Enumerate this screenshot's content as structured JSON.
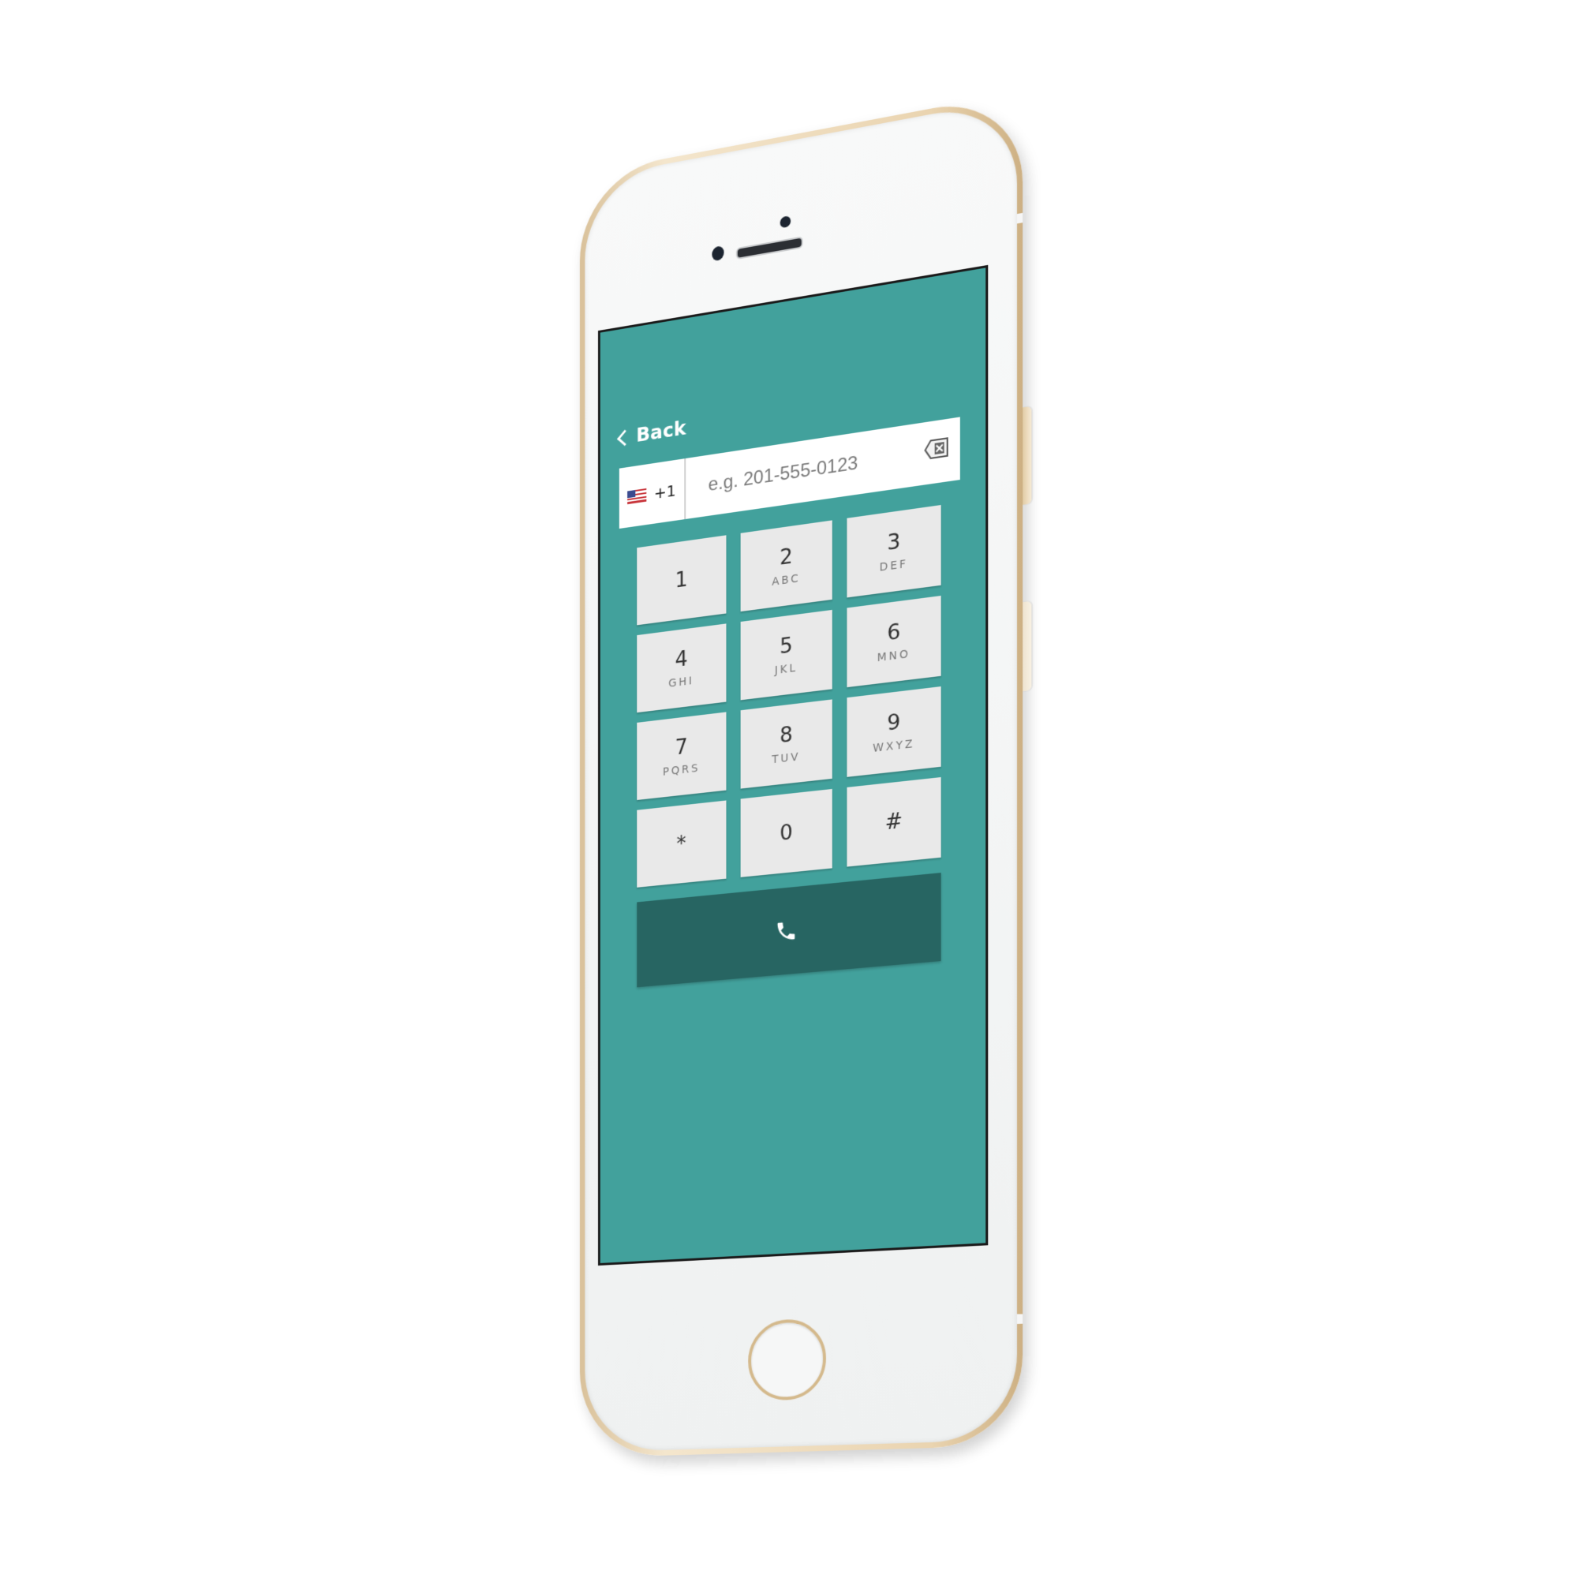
{
  "header": {
    "back_label": "Back"
  },
  "phone_input": {
    "country_code": "+1",
    "country_flag": "us-flag-icon",
    "placeholder": "e.g. 201-555-0123",
    "value": "",
    "clear_icon": "backspace-icon"
  },
  "keypad": {
    "keys": [
      {
        "digit": "1",
        "letters": ""
      },
      {
        "digit": "2",
        "letters": "ABC"
      },
      {
        "digit": "3",
        "letters": "DEF"
      },
      {
        "digit": "4",
        "letters": "GHI"
      },
      {
        "digit": "5",
        "letters": "JKL"
      },
      {
        "digit": "6",
        "letters": "MNO"
      },
      {
        "digit": "7",
        "letters": "PQRS"
      },
      {
        "digit": "8",
        "letters": "TUV"
      },
      {
        "digit": "9",
        "letters": "WXYZ"
      },
      {
        "digit": "*",
        "letters": ""
      },
      {
        "digit": "0",
        "letters": ""
      },
      {
        "digit": "#",
        "letters": ""
      }
    ]
  },
  "call_button": {
    "icon": "phone-icon"
  },
  "colors": {
    "screen_background": "#42a19c",
    "key_background": "#e9e9e9",
    "call_button": "#276562",
    "device_frame": "#ead4b0"
  }
}
